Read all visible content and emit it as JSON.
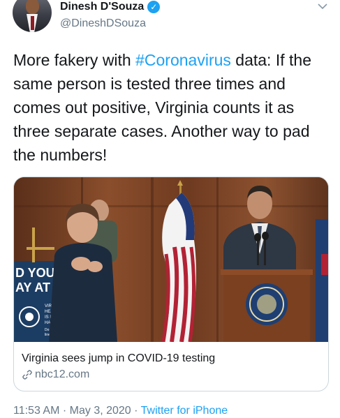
{
  "author": {
    "display_name": "Dinesh D'Souza",
    "handle": "@DineshDSouza",
    "verified": true
  },
  "tweet": {
    "text_before": "More fakery with ",
    "hashtag": "#Coronavirus",
    "text_after": " data: If the same person is tested three times and comes out positive, Virginia counts it as three separate cases. Another way to pad the numbers!"
  },
  "card": {
    "title": "Virginia sees jump in COVID-19 testing",
    "domain": "nbc12.com",
    "image": {
      "sign_text_1": "D YOU",
      "sign_text_2": "AY AT",
      "sign_small_text_1": "VIRGIN",
      "sign_small_text_2": "HEALTH",
      "sign_small_text_3": "IS IN Y",
      "sign_small_text_4": "HAND",
      "sign_small_text_5": "Do your",
      "sign_small_text_6": "line of d"
    }
  },
  "meta": {
    "time": "11:53 AM",
    "separator1": " · ",
    "date": "May 3, 2020",
    "separator2": " · ",
    "source": "Twitter for iPhone"
  },
  "icons": {
    "verified": "verified-badge-icon",
    "caret": "chevron-down-icon",
    "link": "link-icon"
  },
  "colors": {
    "link_blue": "#1da1f2",
    "secondary_text": "#657786",
    "border": "#ccd6dd"
  }
}
